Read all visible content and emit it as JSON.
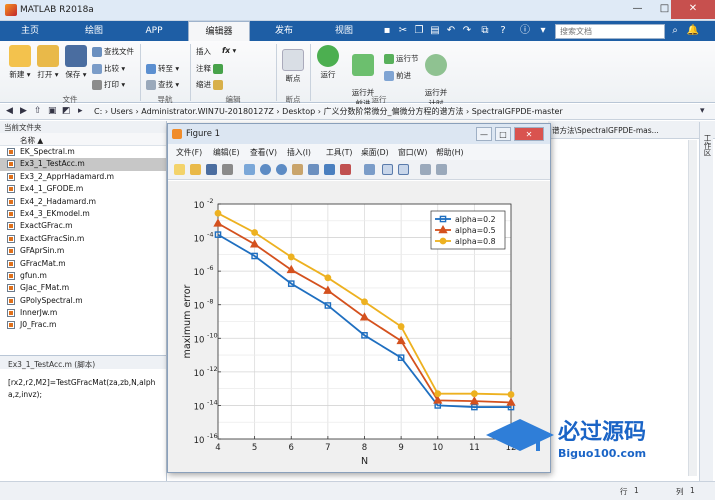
{
  "window": {
    "title": "MATLAB R2018a",
    "min": "—",
    "max": "□",
    "close": "✕"
  },
  "tabs": [
    {
      "label": "主页"
    },
    {
      "label": "绘图"
    },
    {
      "label": "APP"
    },
    {
      "label": "编辑器"
    },
    {
      "label": "发布"
    },
    {
      "label": "视图"
    }
  ],
  "search": {
    "placeholder": "搜索文档"
  },
  "ribbon": {
    "file": {
      "new": "新建",
      "open": "打开",
      "save": "保存",
      "find_files": "查找文件",
      "compare": "比较",
      "print": "打印",
      "group": "文件"
    },
    "nav": {
      "goto": "转至",
      "find": "查找",
      "group": "导航"
    },
    "edit": {
      "insert": "插入",
      "comment": "注释",
      "indent": "缩进",
      "fx": "fx",
      "group": "编辑"
    },
    "breakpoint": {
      "label": "断点",
      "group": "断点"
    },
    "run": {
      "run": "运行",
      "run_advance": "运行并\n前进",
      "run_section": "运行节",
      "advance": "前进",
      "run_time": "运行并\n计时",
      "group": "运行"
    }
  },
  "address": {
    "crumbs": "C: › Users › Administrator.WIN7U-20180127Z › Desktop › 广义分数阶常微分_偏微分方程的谱方法 › SpectralGFPDE-master"
  },
  "left_panel": {
    "title": "当前文件夹",
    "header": "名称 ▲",
    "files": [
      "EK_Spectral.m",
      "Ex3_1_TestAcc.m",
      "Ex3_2_ApprHadamard.m",
      "Ex4_1_GFODE.m",
      "Ex4_2_Hadamard.m",
      "Ex4_3_EKmodel.m",
      "ExactGFrac.m",
      "ExactGFracSin.m",
      "GFAprSin.m",
      "GFracMat.m",
      "gfun.m",
      "GJac_FMat.m",
      "GPolySpectral.m",
      "InnerJw.m",
      "J0_Frac.m"
    ],
    "selected_index": 1
  },
  "detail": {
    "title": "Ex3_1_TestAcc.m  (脚本)",
    "code": "[rx2,r2,M2]=TestGFracMat(za,zb,N,alpha,z,invz);"
  },
  "right_panel": {
    "tab_text": "谱方法\\SpectralGFPDE-mas...",
    "side_tab": "工作区"
  },
  "status": {
    "row": "行",
    "col": "列",
    "row_val": "1",
    "col_val": "1"
  },
  "figure": {
    "title": "Figure 1",
    "menu": [
      "文件(F)",
      "编辑(E)",
      "查看(V)",
      "插入(I)",
      "工具(T)",
      "桌面(D)",
      "窗口(W)",
      "帮助(H)"
    ]
  },
  "watermark": {
    "text": "必过源码",
    "url": "Biguo100.com"
  },
  "chart_data": {
    "type": "line",
    "xlabel": "N",
    "ylabel": "maximum error",
    "xlim": [
      4,
      12
    ],
    "ylim_log10": [
      -16,
      -2
    ],
    "yscale": "log",
    "grid": true,
    "legend_position": "top-right",
    "x": [
      4,
      5,
      6,
      7,
      8,
      9,
      10,
      11,
      12
    ],
    "x_ticks": [
      "4",
      "5",
      "6",
      "7",
      "8",
      "9",
      "10",
      "11",
      "12"
    ],
    "y_ticks": [
      {
        "base": "10",
        "exp": "-2"
      },
      {
        "base": "10",
        "exp": "-4"
      },
      {
        "base": "10",
        "exp": "-6"
      },
      {
        "base": "10",
        "exp": "-8"
      },
      {
        "base": "10",
        "exp": "-10"
      },
      {
        "base": "10",
        "exp": "-12"
      },
      {
        "base": "10",
        "exp": "-14"
      },
      {
        "base": "10",
        "exp": "-16"
      }
    ],
    "series": [
      {
        "name": "alpha=0.2",
        "color": "#1f6fc0",
        "marker": "square",
        "values": [
          0.00015,
          8e-06,
          1.8e-07,
          9e-09,
          1.5e-10,
          7e-12,
          1e-14,
          8e-15,
          8e-15
        ]
      },
      {
        "name": "alpha=0.5",
        "color": "#d4511e",
        "marker": "triangle",
        "values": [
          0.0007,
          4e-05,
          1.2e-06,
          7e-08,
          1.8e-09,
          7e-11,
          2e-14,
          1.8e-14,
          1.5e-14
        ]
      },
      {
        "name": "alpha=0.8",
        "color": "#edb120",
        "marker": "circle",
        "values": [
          0.0028,
          0.0002,
          7e-06,
          4e-07,
          1.5e-08,
          5e-10,
          5e-14,
          5e-14,
          4.5e-14
        ]
      }
    ]
  }
}
